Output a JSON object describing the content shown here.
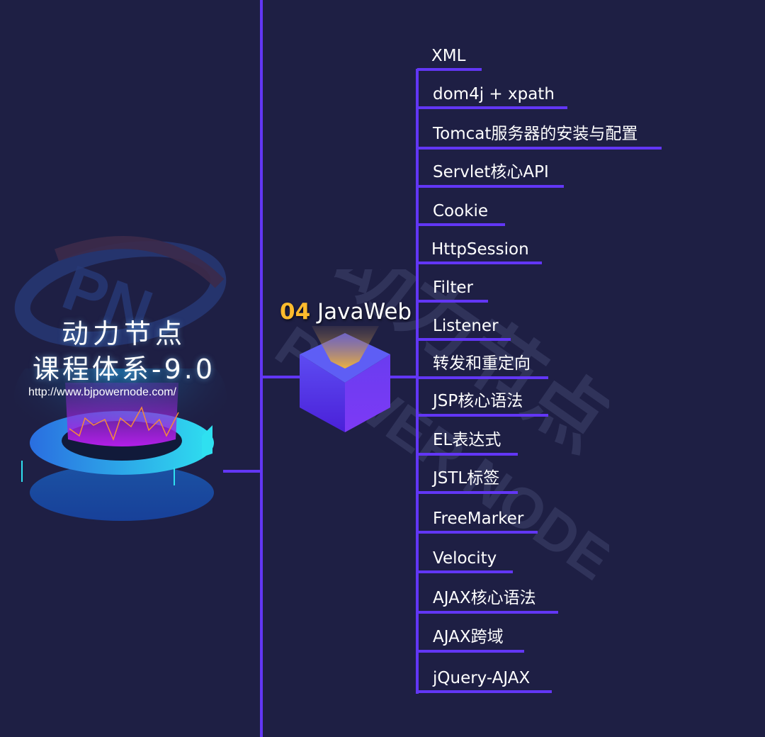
{
  "brand": {
    "title_line1": "动力节点",
    "title_line2": "课程体系-9.0",
    "url": "http://www.bjpowernode.com/"
  },
  "topic": {
    "number": "04",
    "name": "JavaWeb"
  },
  "watermark": {
    "logo_text": "PN",
    "text": "POWER NODE"
  },
  "colors": {
    "background": "#1e1f44",
    "line": "#6236f5",
    "topic_number": "#fdbb2d",
    "text": "#ffffff"
  },
  "items": [
    {
      "label": "XML"
    },
    {
      "label": "dom4j + xpath"
    },
    {
      "label": "Tomcat服务器的安装与配置"
    },
    {
      "label": "Servlet核心API"
    },
    {
      "label": "Cookie"
    },
    {
      "label": "HttpSession"
    },
    {
      "label": "Filter"
    },
    {
      "label": "Listener"
    },
    {
      "label": "转发和重定向"
    },
    {
      "label": "JSP核心语法"
    },
    {
      "label": "EL表达式"
    },
    {
      "label": "JSTL标签"
    },
    {
      "label": "FreeMarker"
    },
    {
      "label": "Velocity"
    },
    {
      "label": "AJAX核心语法"
    },
    {
      "label": "AJAX跨域"
    },
    {
      "label": "jQuery-AJAX"
    }
  ]
}
